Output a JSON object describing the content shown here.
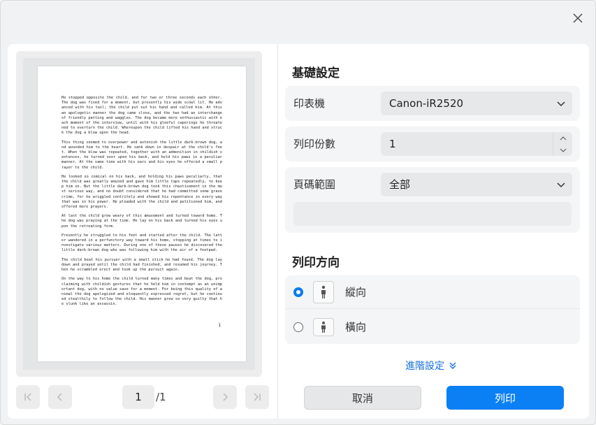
{
  "icons": {
    "close": "close-icon",
    "first": "first-page-icon",
    "prev": "chevron-left-icon",
    "next": "chevron-right-icon",
    "last": "last-page-icon",
    "dropdown": "chevron-down-icon",
    "spin_up": "chevron-up-icon",
    "spin_down": "chevron-down-icon",
    "portrait": "portrait-person-icon",
    "landscape": "landscape-person-icon",
    "advanced": "double-chevron-down-icon"
  },
  "colors": {
    "accent": "#0b80f4",
    "link": "#1570d9"
  },
  "preview": {
    "paragraphs": [
      "He stopped opposite the child, and for two or three seconds each other. The dog was fixed for a moment, but presently his wide scowl lit. He advanced with his tail; the child put out his hand and called him. At this an apologetic manner the dog came close, and the two had an interchange of friendly patting and waggles. The dog became more enthusiastic with each moment of the interview, until with his gleeful caperings he threatened to overturn the child. Whereupon the child lifted his hand and struck the dog a blow upon the head.",
      "This thing seemed to overpower and astonish the little dark-brown dog, and wounded him to the heart. He sank down in despair at the child's feet. When the blow was repeated, together with an admonition in childish sentences, he turned over upon his back, and held his paws in a peculiar manner. At the same time with his ears and his eyes he offered a small prayer to the child.",
      "He looked so comical on his back, and holding his paws peculiarly, that the child was greatly amused and gave him little taps repeatedly, to keep him so. But the little dark-brown dog took this chastisement in the most serious way, and no doubt considered that he had committed some grave crime, for he wriggled contritely and showed his repentance in every way that was in his power. He pleaded with the child and petitioned him, and offered more prayers.",
      "At last the child grew weary of this amusement and turned toward home. The dog was praying at the time. He lay on his back and turned his eyes upon the retreating form.",
      "Presently he struggled to his feet and started after the child. The latter wandered in a perfunctory way toward his home, stopping at times to investigate various matters. During one of these pauses he discovered the little dark-brown dog who was following him with the air of a footpad.",
      "The child beat his pursuer with a small stick he had found. The dog lay down and prayed until the child had finished, and resumed his journey. Then he scrambled erect and took up the pursuit again.",
      "On the way to his home the child turned many times and beat the dog, proclaiming with childish gestures that he held him in contempt as an unimportant dog, with no value save for a moment. For being this quality of animal the dog apologized and eloquently expressed regret, but he continued stealthily to follow the child. His manner grew so very guilty that he slunk like an assassin."
    ],
    "page_number": "1"
  },
  "pager": {
    "current_page": "1",
    "total": "/1"
  },
  "settings": {
    "basic_title": "基礎設定",
    "printer_label": "印表機",
    "printer_value": "Canon-iR2520",
    "copies_label": "列印份數",
    "copies_value": "1",
    "range_label": "頁碼範圍",
    "range_value": "全部",
    "orientation_title": "列印方向",
    "portrait_label": "縱向",
    "landscape_label": "橫向",
    "advanced_label": "進階設定"
  },
  "actions": {
    "cancel_label": "取消",
    "print_label": "列印"
  }
}
